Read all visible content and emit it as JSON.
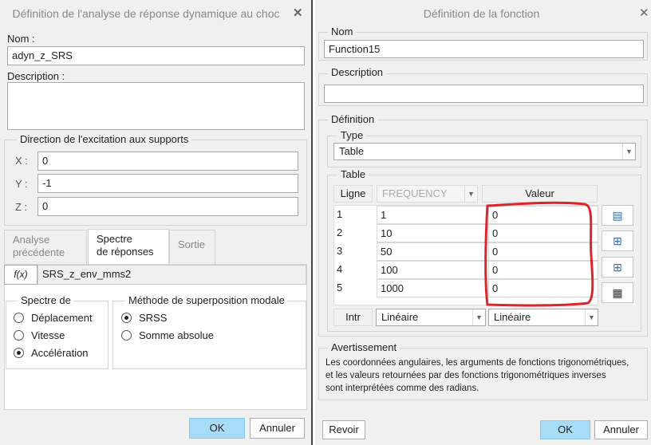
{
  "left": {
    "title": "Définition de l'analyse de réponse dynamique au choc",
    "close_icon": "close-icon",
    "name_label": "Nom :",
    "name_value": "adyn_z_SRS",
    "description_label": "Description :",
    "description_value": "",
    "direction": {
      "legend": "Direction de l'excitation aux supports",
      "x_label": "X :",
      "x_value": "0",
      "y_label": "Y :",
      "y_value": "-1",
      "z_label": "Z :",
      "z_value": "0"
    },
    "tabs": [
      {
        "label": "Analyse\nprécédente"
      },
      {
        "label": "Spectre\nde réponses"
      },
      {
        "label": "Sortie"
      }
    ],
    "fx_label": "f(x)",
    "function_value": "SRS_z_env_mms2",
    "spectre": {
      "legend": "Spectre de",
      "options": [
        "Déplacement",
        "Vitesse",
        "Accélération"
      ],
      "selected": "Accélération"
    },
    "methode": {
      "legend": "Méthode de superposition modale",
      "options": [
        "SRSS",
        "Somme absolue"
      ],
      "selected": "SRSS"
    },
    "ok": "OK",
    "cancel": "Annuler"
  },
  "right": {
    "title": "Définition de la fonction",
    "name_legend": "Nom",
    "name_value": "Function15",
    "description_legend": "Description",
    "description_value": "",
    "definition_legend": "Définition",
    "type_legend": "Type",
    "type_value": "Table",
    "table_legend": "Table",
    "headers": {
      "ligne": "Ligne",
      "frequency": "FREQUENCY",
      "valeur": "Valeur"
    },
    "rows": [
      {
        "n": "1",
        "freq": "1",
        "val": "0"
      },
      {
        "n": "2",
        "freq": "10",
        "val": "0"
      },
      {
        "n": "3",
        "freq": "50",
        "val": "0"
      },
      {
        "n": "4",
        "freq": "100",
        "val": "0"
      },
      {
        "n": "5",
        "freq": "1000",
        "val": "0"
      }
    ],
    "intr_label": "Intr",
    "interp1": "Linéaire",
    "interp2": "Linéaire",
    "warning_legend": "Avertissement",
    "warning_lines": [
      "Les coordonnées angulaires, les arguments de fonctions trigonométriques,",
      "et les valeurs retournées par des fonctions trigonométriques inverses",
      "sont interprétées comme des radians."
    ],
    "revoir": "Revoir",
    "ok": "OK",
    "cancel": "Annuler",
    "annotation_color": "#d9262b"
  }
}
